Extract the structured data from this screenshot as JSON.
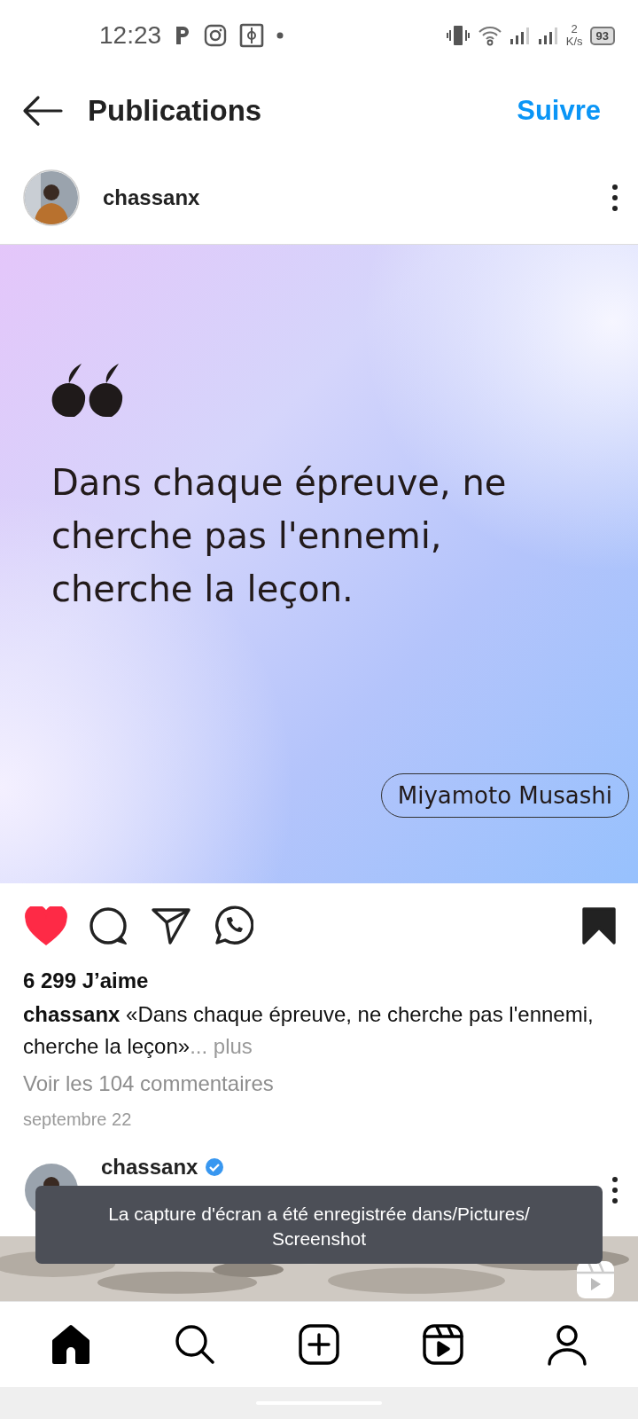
{
  "status_bar": {
    "time": "12:23",
    "speed_value": "2",
    "speed_unit": "K/s",
    "battery": "93"
  },
  "header": {
    "title": "Publications",
    "follow": "Suivre"
  },
  "post": {
    "username": "chassanx",
    "quote": "Dans chaque épreuve, ne cherche pas l'ennemi, cherche la leçon.",
    "author": "Miyamoto Musashi",
    "liked": true,
    "saved": true,
    "likes": "6 299 J’aime",
    "caption": "**chassanx** «Dans chaque épreuve, ne cherche pas l'ennemi, cherche la leçon»",
    "more": "... plus",
    "comments": "Voir les 104 commentaires",
    "date": "septembre 22"
  },
  "next_post": {
    "username": "chassanx",
    "verified": true
  },
  "toast": "La capture d'écran a été enregistrée dans/Pictures/ Screenshot",
  "nav": [
    {
      "kind": "home",
      "selected": true
    },
    {
      "kind": "search",
      "selected": false
    },
    {
      "kind": "create",
      "selected": false
    },
    {
      "kind": "reels",
      "selected": false
    },
    {
      "kind": "profile",
      "selected": false
    }
  ]
}
